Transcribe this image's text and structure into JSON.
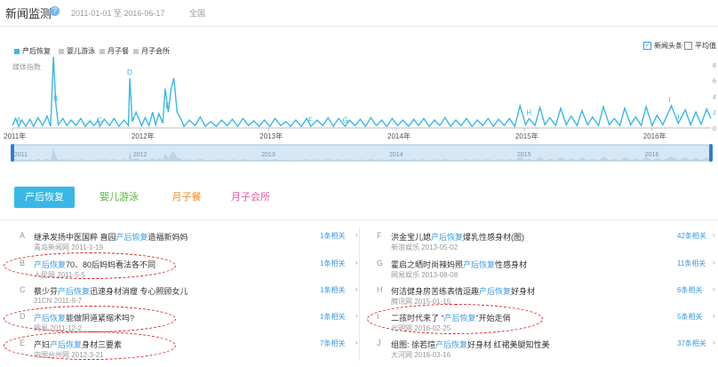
{
  "header": {
    "title": "新闻监测",
    "help_icon": "?",
    "date_range": "2011-01-01 至 2016-06-17",
    "region": "全国"
  },
  "legend": {
    "series": [
      {
        "label": "产后恢复",
        "color": "#3ab7e6"
      },
      {
        "label": "婴儿游泳",
        "color": "#c8c8c8"
      },
      {
        "label": "月子餐",
        "color": "#c8c8c8"
      },
      {
        "label": "月子会所",
        "color": "#c8c8c8"
      }
    ],
    "checkbox_headline": {
      "label": "新闻头条",
      "checked": true
    },
    "checkbox_average": {
      "label": "平均值",
      "checked": false
    }
  },
  "chart_data": {
    "type": "line",
    "ylabel": "媒体指数",
    "y_ticks": [
      "8",
      "6",
      "4",
      "2",
      "0"
    ],
    "ylim": [
      0,
      9
    ],
    "x_tick_labels": [
      "2011年",
      "2012年",
      "2013年",
      "2014年",
      "2015年",
      "2016年"
    ],
    "x_domain": [
      "2011-01-01",
      "2016-06-17"
    ],
    "series": [
      {
        "color": "#3ab7e6",
        "points": [
          [
            "2011-01-01",
            0.3
          ],
          [
            "2011-01-10",
            1.2
          ],
          [
            "2011-01-19",
            0.2
          ],
          [
            "2011-01-28",
            1.0
          ],
          [
            "2011-02-08",
            0.2
          ],
          [
            "2011-02-20",
            1.1
          ],
          [
            "2011-03-02",
            0.2
          ],
          [
            "2011-03-15",
            1.3
          ],
          [
            "2011-03-28",
            0.3
          ],
          [
            "2011-04-10",
            1.5
          ],
          [
            "2011-04-20",
            0.2
          ],
          [
            "2011-04-28",
            9.0
          ],
          [
            "2011-05-05",
            3.0
          ],
          [
            "2011-05-12",
            0.4
          ],
          [
            "2011-05-25",
            1.2
          ],
          [
            "2011-06-05",
            0.3
          ],
          [
            "2011-06-18",
            1.0
          ],
          [
            "2011-07-01",
            0.3
          ],
          [
            "2011-07-15",
            1.2
          ],
          [
            "2011-07-28",
            0.2
          ],
          [
            "2011-08-10",
            0.9
          ],
          [
            "2011-08-22",
            0.3
          ],
          [
            "2011-09-03",
            1.0
          ],
          [
            "2011-09-07",
            0.2
          ],
          [
            "2011-09-20",
            1.1
          ],
          [
            "2011-10-05",
            0.3
          ],
          [
            "2011-10-18",
            1.2
          ],
          [
            "2011-11-01",
            0.2
          ],
          [
            "2011-11-15",
            1.0
          ],
          [
            "2011-11-28",
            0.3
          ],
          [
            "2011-12-02",
            6.3
          ],
          [
            "2011-12-09",
            0.8
          ],
          [
            "2011-12-20",
            2.0
          ],
          [
            "2012-01-05",
            0.3
          ],
          [
            "2012-01-15",
            1.3
          ],
          [
            "2012-01-26",
            0.3
          ],
          [
            "2012-02-05",
            2.0
          ],
          [
            "2012-02-14",
            0.4
          ],
          [
            "2012-02-23",
            1.8
          ],
          [
            "2012-03-05",
            0.6
          ],
          [
            "2012-03-12",
            5.0
          ],
          [
            "2012-03-21",
            2.0
          ],
          [
            "2012-03-29",
            5.0
          ],
          [
            "2012-04-06",
            6.3
          ],
          [
            "2012-04-15",
            2.0
          ],
          [
            "2012-04-25",
            1.2
          ],
          [
            "2012-05-05",
            0.2
          ],
          [
            "2012-05-20",
            1.0
          ],
          [
            "2012-06-05",
            0.3
          ],
          [
            "2012-06-20",
            1.4
          ],
          [
            "2012-07-05",
            0.2
          ],
          [
            "2012-07-20",
            0.8
          ],
          [
            "2012-08-05",
            0.2
          ],
          [
            "2012-08-20",
            1.0
          ],
          [
            "2012-09-05",
            0.3
          ],
          [
            "2012-09-20",
            1.1
          ],
          [
            "2012-10-05",
            0.2
          ],
          [
            "2012-10-20",
            1.2
          ],
          [
            "2012-11-05",
            0.3
          ],
          [
            "2012-11-20",
            0.9
          ],
          [
            "2012-12-05",
            0.2
          ],
          [
            "2012-12-20",
            1.0
          ],
          [
            "2013-01-05",
            0.2
          ],
          [
            "2013-01-20",
            1.2
          ],
          [
            "2013-02-05",
            0.3
          ],
          [
            "2013-02-20",
            0.8
          ],
          [
            "2013-03-05",
            0.2
          ],
          [
            "2013-03-20",
            1.0
          ],
          [
            "2013-04-05",
            0.2
          ],
          [
            "2013-04-20",
            1.2
          ],
          [
            "2013-05-02",
            0.2
          ],
          [
            "2013-05-20",
            1.0
          ],
          [
            "2013-06-05",
            0.3
          ],
          [
            "2013-06-20",
            1.3
          ],
          [
            "2013-07-05",
            0.2
          ],
          [
            "2013-07-20",
            1.2
          ],
          [
            "2013-08-08",
            0.2
          ],
          [
            "2013-08-20",
            1.0
          ],
          [
            "2013-09-05",
            0.3
          ],
          [
            "2013-09-20",
            1.1
          ],
          [
            "2013-10-05",
            0.2
          ],
          [
            "2013-10-20",
            1.3
          ],
          [
            "2013-11-05",
            0.3
          ],
          [
            "2013-11-20",
            1.0
          ],
          [
            "2013-12-05",
            0.2
          ],
          [
            "2013-12-20",
            1.2
          ],
          [
            "2014-01-05",
            0.3
          ],
          [
            "2014-01-20",
            1.0
          ],
          [
            "2014-02-05",
            0.2
          ],
          [
            "2014-02-20",
            1.1
          ],
          [
            "2014-03-05",
            0.3
          ],
          [
            "2014-03-20",
            1.2
          ],
          [
            "2014-04-05",
            0.2
          ],
          [
            "2014-04-20",
            1.0
          ],
          [
            "2014-05-05",
            0.3
          ],
          [
            "2014-05-20",
            1.3
          ],
          [
            "2014-06-05",
            0.2
          ],
          [
            "2014-06-20",
            1.0
          ],
          [
            "2014-07-05",
            0.3
          ],
          [
            "2014-07-20",
            1.2
          ],
          [
            "2014-08-05",
            0.2
          ],
          [
            "2014-08-20",
            1.0
          ],
          [
            "2014-09-05",
            0.3
          ],
          [
            "2014-09-20",
            1.2
          ],
          [
            "2014-10-05",
            0.2
          ],
          [
            "2014-10-20",
            1.1
          ],
          [
            "2014-11-05",
            0.3
          ],
          [
            "2014-11-20",
            1.2
          ],
          [
            "2014-12-05",
            0.2
          ],
          [
            "2014-12-20",
            2.8
          ],
          [
            "2015-01-05",
            0.4
          ],
          [
            "2015-01-15",
            1.2
          ],
          [
            "2015-02-01",
            0.3
          ],
          [
            "2015-02-15",
            2.6
          ],
          [
            "2015-03-01",
            0.4
          ],
          [
            "2015-03-15",
            1.3
          ],
          [
            "2015-04-01",
            0.3
          ],
          [
            "2015-04-15",
            2.5
          ],
          [
            "2015-05-01",
            0.4
          ],
          [
            "2015-05-15",
            1.5
          ],
          [
            "2015-06-01",
            0.3
          ],
          [
            "2015-06-15",
            2.2
          ],
          [
            "2015-07-01",
            0.4
          ],
          [
            "2015-07-15",
            1.4
          ],
          [
            "2015-08-01",
            0.3
          ],
          [
            "2015-08-15",
            2.7
          ],
          [
            "2015-09-01",
            0.4
          ],
          [
            "2015-09-15",
            1.2
          ],
          [
            "2015-10-01",
            0.3
          ],
          [
            "2015-10-15",
            2.5
          ],
          [
            "2015-11-01",
            0.4
          ],
          [
            "2015-11-15",
            1.4
          ],
          [
            "2015-12-01",
            0.3
          ],
          [
            "2015-12-15",
            2.7
          ],
          [
            "2016-01-01",
            0.3
          ],
          [
            "2016-01-15",
            1.6
          ],
          [
            "2016-02-01",
            0.4
          ],
          [
            "2016-02-25",
            2.8
          ],
          [
            "2016-03-16",
            0.6
          ],
          [
            "2016-04-05",
            2.3
          ],
          [
            "2016-04-20",
            0.4
          ],
          [
            "2016-05-05",
            2.0
          ],
          [
            "2016-05-20",
            0.5
          ],
          [
            "2016-06-05",
            2.4
          ],
          [
            "2016-06-17",
            1.2
          ]
        ]
      }
    ],
    "markers": [
      {
        "label": "A",
        "x": "2011-01-19"
      },
      {
        "label": "B",
        "x": "2011-05-05"
      },
      {
        "label": "C",
        "x": "2011-09-07"
      },
      {
        "label": "D",
        "x": "2011-12-02"
      },
      {
        "label": "E",
        "x": "2012-03-21"
      },
      {
        "label": "F",
        "x": "2013-05-02"
      },
      {
        "label": "G",
        "x": "2013-08-08"
      },
      {
        "label": "H",
        "x": "2015-01-15"
      },
      {
        "label": "I",
        "x": "2016-02-25"
      },
      {
        "label": "J",
        "x": "2016-03-16"
      }
    ]
  },
  "overview": {
    "year_labels": [
      "2011",
      "2012",
      "2013",
      "2014",
      "2015",
      "2016"
    ]
  },
  "tabs": [
    "产后恢复",
    "婴儿游泳",
    "月子餐",
    "月子会所"
  ],
  "news_left": [
    {
      "letter": "A",
      "before": "继承发扬中医国粹 喜园",
      "kw": "产后恢复",
      "after": "造福新妈妈",
      "source": "青岛新闻网 2011-1-19",
      "related": "1条相关"
    },
    {
      "letter": "B",
      "before": "",
      "kw": "产后恢复",
      "after": "70、80后妈妈看法各不同",
      "source": "人民网 2011-5-5",
      "related": "1条相关"
    },
    {
      "letter": "C",
      "before": "蔡少芬",
      "kw": "产后恢复",
      "after": "迅速身材消瘦 专心照顾女儿",
      "source": "21CN 2011-9-7",
      "related": "1条相关"
    },
    {
      "letter": "D",
      "before": "",
      "kw": "产后恢复",
      "after": "能做阴道紧缩术吗?",
      "source": "网易 2011-12-2",
      "related": "1条相关"
    },
    {
      "letter": "E",
      "before": "产妇",
      "kw": "产后恢复",
      "after": "身材三要素",
      "source": "中国台州网 2012-3-21",
      "related": "7条相关"
    }
  ],
  "news_right": [
    {
      "letter": "F",
      "before": "洪金宝儿媳",
      "kw": "产后恢复",
      "after": "爆乳性感身材(图)",
      "source": "新浪娱乐 2013-05-02",
      "related": "42条相关"
    },
    {
      "letter": "G",
      "before": "霍启之晒时尚辣妈照",
      "kw": "产后恢复",
      "after": "性感身材",
      "source": "网易娱乐 2013-08-08",
      "related": "11条相关"
    },
    {
      "letter": "H",
      "before": "何洁健身房苦练表情逗趣",
      "kw": "产后恢复",
      "after": "好身材",
      "source": "腾讯网 2015-01-15",
      "related": "6条相关"
    },
    {
      "letter": "I",
      "before": "二孩时代来了 “",
      "kw": "产后恢复",
      "after": "”开始走俏",
      "source": "光明网 2016-02-25",
      "related": "5条相关"
    },
    {
      "letter": "J",
      "before": "组图: 徐若瑄",
      "kw": "产后恢复",
      "after": "好身材 红裙美腿知性美",
      "source": "大河网 2016-03-16",
      "related": "37条相关"
    }
  ]
}
